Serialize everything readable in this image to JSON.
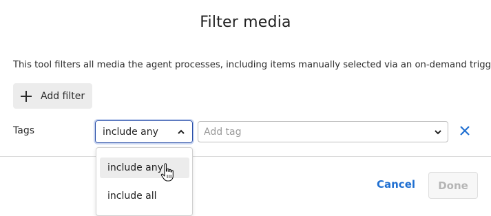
{
  "dialog": {
    "title": "Filter media",
    "description": "This tool filters all media the agent processes, including items manually selected via an on-demand trigger.",
    "add_filter_label": "Add filter"
  },
  "filter_row": {
    "label": "Tags",
    "mode_selected": "include any",
    "mode_options": [
      "include any",
      "include all"
    ],
    "tag_placeholder": "Add tag"
  },
  "footer": {
    "cancel_label": "Cancel",
    "done_label": "Done"
  },
  "colors": {
    "accent": "#1f6fd1",
    "select_border": "#2a4fa8",
    "disabled_text": "#b5b5b5"
  },
  "icons": {
    "add": "plus-icon",
    "select_toggle": "chevron-up-icon",
    "tag_toggle": "chevron-down-icon",
    "remove": "close-icon",
    "pointer": "hand-cursor-icon"
  }
}
